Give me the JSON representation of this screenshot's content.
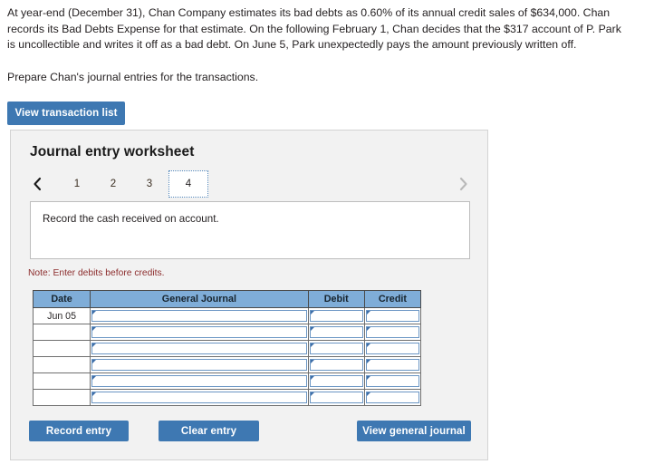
{
  "problem": {
    "statement": "At year-end (December 31), Chan Company estimates its bad debts as 0.60% of its annual credit sales of $634,000. Chan records its Bad Debts Expense for that estimate. On the following February 1, Chan decides that the $317 account of P. Park is uncollectible and writes it off as a bad debt. On June 5, Park unexpectedly pays the amount previously written off.",
    "prepare": "Prepare Chan's journal entries for the transactions."
  },
  "toolbar": {
    "view_transaction_list_label": "View transaction list"
  },
  "worksheet": {
    "title": "Journal entry worksheet",
    "tabs": [
      {
        "label": "1",
        "active": false
      },
      {
        "label": "2",
        "active": false
      },
      {
        "label": "3",
        "active": false
      },
      {
        "label": "4",
        "active": true
      }
    ],
    "prev_icon": "chevron-left-icon",
    "next_icon": "chevron-right-icon",
    "instruction": "Record the cash received on account.",
    "note": "Note: Enter debits before credits."
  },
  "journal": {
    "columns": [
      "Date",
      "General Journal",
      "Debit",
      "Credit"
    ],
    "rows": [
      {
        "date": "Jun 05",
        "general_journal": "",
        "debit": "",
        "credit": ""
      },
      {
        "date": "",
        "general_journal": "",
        "debit": "",
        "credit": ""
      },
      {
        "date": "",
        "general_journal": "",
        "debit": "",
        "credit": ""
      },
      {
        "date": "",
        "general_journal": "",
        "debit": "",
        "credit": ""
      },
      {
        "date": "",
        "general_journal": "",
        "debit": "",
        "credit": ""
      },
      {
        "date": "",
        "general_journal": "",
        "debit": "",
        "credit": ""
      }
    ]
  },
  "actions": {
    "record_entry_label": "Record entry",
    "clear_entry_label": "Clear entry",
    "view_general_journal_label": "View general journal"
  },
  "colors": {
    "button_blue": "#3e78b2",
    "table_header_blue": "#7fadd8",
    "note_red": "#8c2d2d",
    "panel_gray": "#f2f2f2",
    "field_border_blue": "#6b96c4"
  }
}
